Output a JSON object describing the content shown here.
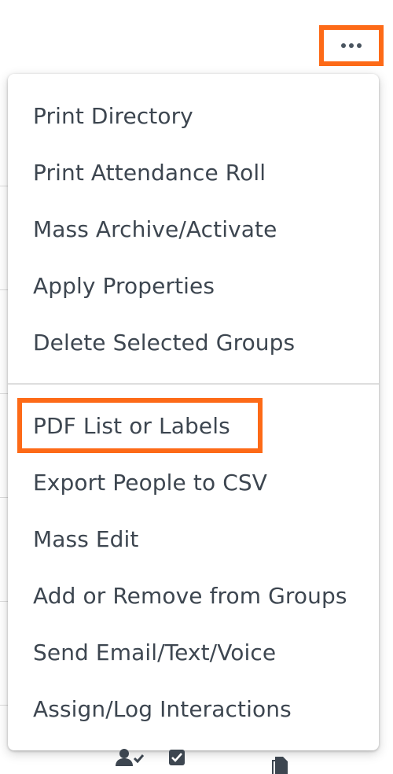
{
  "toolbar": {
    "more_button_icon": "ellipsis-horizontal-icon",
    "more_button_accent": "#fd6a17"
  },
  "menu": {
    "section_one": [
      "Print Directory",
      "Print Attendance Roll",
      "Mass Archive/Activate",
      "Apply Properties",
      "Delete Selected Groups"
    ],
    "section_two": [
      "PDF List or Labels",
      "Export People to CSV",
      "Mass Edit",
      "Add or Remove from Groups",
      "Send Email/Text/Voice",
      "Assign/Log Interactions"
    ],
    "highlighted_item": "PDF List or Labels",
    "highlight_color": "#fd6a17"
  },
  "background_icons": [
    "user-check-icon",
    "checkbox-icon",
    "document-icon"
  ]
}
